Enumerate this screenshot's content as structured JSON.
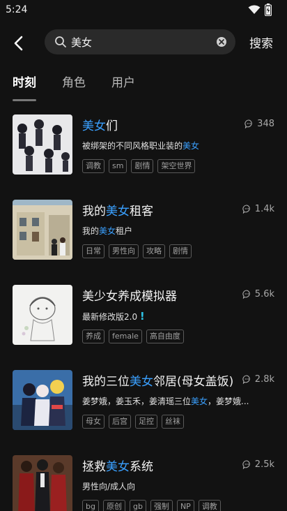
{
  "status_bar": {
    "time": "5:24"
  },
  "header": {
    "search_query": "美女",
    "search_button": "搜索"
  },
  "tabs": [
    {
      "label": "时刻",
      "active": true
    },
    {
      "label": "角色",
      "active": false
    },
    {
      "label": "用户",
      "active": false
    }
  ],
  "results": [
    {
      "title_pre": "",
      "title_hl": "美女",
      "title_post": "们",
      "sub_pre": "被绑架的不同风格职业装的",
      "sub_hl": "美女",
      "sub_post": "",
      "count": "348",
      "tags": [
        "调教",
        "sm",
        "剧情",
        "架空世界"
      ]
    },
    {
      "title_pre": "我的",
      "title_hl": "美女",
      "title_post": "租客",
      "sub_pre": "我的",
      "sub_hl": "美女",
      "sub_post": "租户",
      "count": "1.4k",
      "tags": [
        "日常",
        "男性向",
        "攻略",
        "剧情"
      ]
    },
    {
      "title_pre": "美少女养成模拟器",
      "title_hl": "",
      "title_post": "",
      "sub_pre": "最新修改版2.0",
      "sub_hl": "",
      "sub_post": "",
      "sub_mark": "!",
      "count": "5.6k",
      "tags": [
        "养成",
        "female",
        "高自由度"
      ]
    },
    {
      "title_pre": "我的三位",
      "title_hl": "美女",
      "title_post": "邻居(母女盖饭)",
      "sub_pre": "姜梦娥，姜玉禾，姜清瑶三位",
      "sub_hl": "美女",
      "sub_post": "，姜梦娥...",
      "count": "2.8k",
      "tags": [
        "母女",
        "后宫",
        "足控",
        "丝袜"
      ]
    },
    {
      "title_pre": "拯救",
      "title_hl": "美女",
      "title_post": "系统",
      "sub_pre": "男性向/成人向",
      "sub_hl": "",
      "sub_post": "",
      "count": "2.5k",
      "tags": [
        "bg",
        "原创",
        "gb",
        "强制",
        "NP",
        "调教"
      ]
    }
  ],
  "colors": {
    "background": "#121212",
    "highlight": "#3aa0ff",
    "search_box": "#2a2a2a"
  }
}
